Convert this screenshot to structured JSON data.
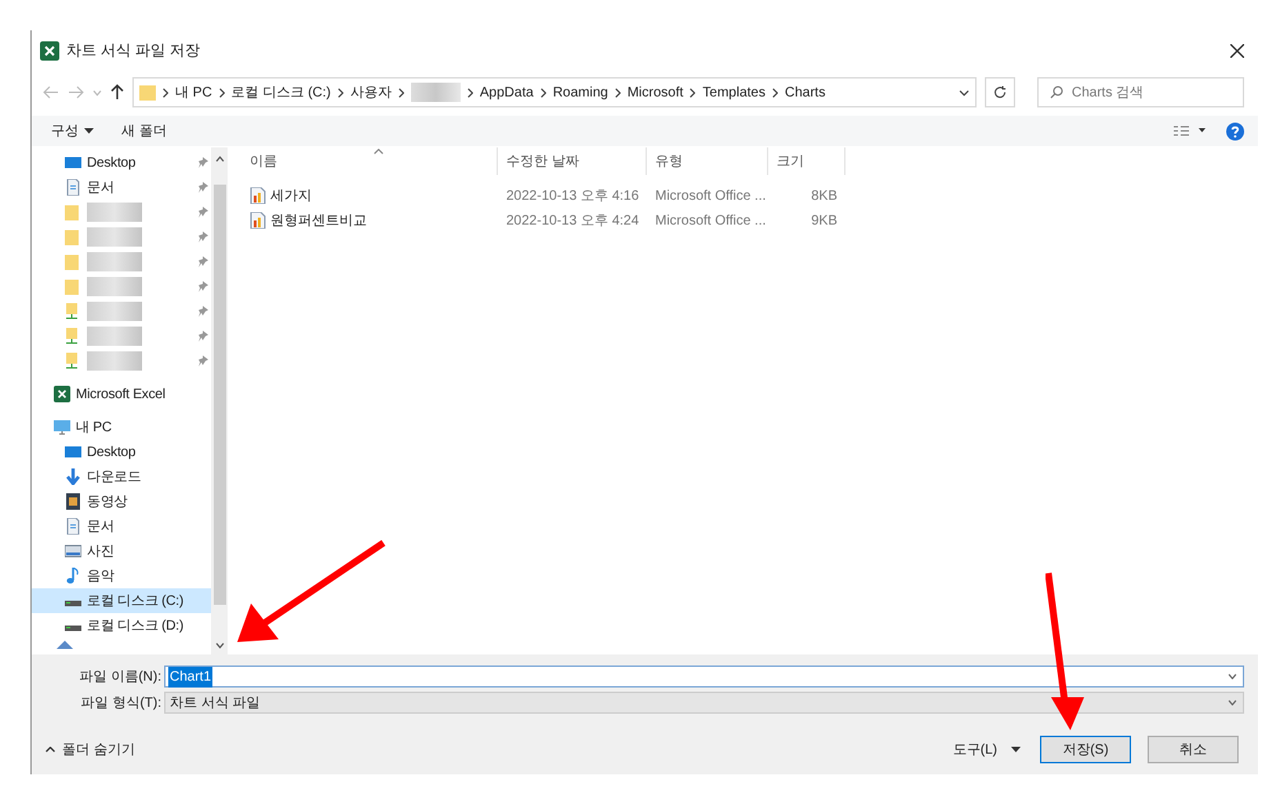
{
  "window": {
    "title": "차트 서식 파일 저장"
  },
  "address": {
    "crumbs": [
      {
        "label": "내 PC",
        "redacted": false
      },
      {
        "label": "로컬 디스크 (C:)",
        "redacted": false
      },
      {
        "label": "사용자",
        "redacted": false
      },
      {
        "redacted": true
      },
      {
        "label": "AppData",
        "redacted": false
      },
      {
        "label": "Roaming",
        "redacted": false
      },
      {
        "label": "Microsoft",
        "redacted": false
      },
      {
        "label": "Templates",
        "redacted": false
      },
      {
        "label": "Charts",
        "redacted": false
      }
    ]
  },
  "search": {
    "placeholder": "Charts 검색"
  },
  "toolbar": {
    "organize": "구성",
    "new_folder": "새 폴더"
  },
  "sidebar": {
    "items": [
      {
        "kind": "desktop",
        "label": "Desktop",
        "pinned": true,
        "selected": false,
        "redacted": false
      },
      {
        "kind": "document",
        "label": "문서",
        "pinned": true,
        "selected": false,
        "redacted": false
      },
      {
        "kind": "folder",
        "pinned": true,
        "selected": false,
        "redacted": true
      },
      {
        "kind": "folder",
        "pinned": true,
        "selected": false,
        "redacted": true
      },
      {
        "kind": "folder",
        "pinned": true,
        "selected": false,
        "redacted": true
      },
      {
        "kind": "folder",
        "pinned": true,
        "selected": false,
        "redacted": true
      },
      {
        "kind": "netfolder",
        "pinned": true,
        "selected": false,
        "redacted": true
      },
      {
        "kind": "netfolder",
        "pinned": true,
        "selected": false,
        "redacted": true
      },
      {
        "kind": "netfolder",
        "pinned": true,
        "selected": false,
        "redacted": true
      },
      {
        "kind": "excel",
        "label": "Microsoft Excel",
        "pinned": false,
        "selected": false,
        "redacted": false,
        "top": true
      },
      {
        "kind": "pc",
        "label": "내 PC",
        "pinned": false,
        "selected": false,
        "redacted": false,
        "top": true,
        "children": [
          {
            "kind": "desktop",
            "label": "Desktop",
            "pinned": false,
            "selected": false,
            "redacted": false
          },
          {
            "kind": "download",
            "label": "다운로드",
            "pinned": false,
            "selected": false,
            "redacted": false
          },
          {
            "kind": "video",
            "label": "동영상",
            "pinned": false,
            "selected": false,
            "redacted": false
          },
          {
            "kind": "document",
            "label": "문서",
            "pinned": false,
            "selected": false,
            "redacted": false
          },
          {
            "kind": "picture",
            "label": "사진",
            "pinned": false,
            "selected": false,
            "redacted": false
          },
          {
            "kind": "music",
            "label": "음악",
            "pinned": false,
            "selected": false,
            "redacted": false
          },
          {
            "kind": "drive",
            "label": "로컬 디스크 (C:)",
            "pinned": false,
            "selected": true,
            "redacted": false
          },
          {
            "kind": "drive",
            "label": "로컬 디스크 (D:)",
            "pinned": false,
            "selected": false,
            "redacted": false
          }
        ]
      }
    ]
  },
  "table": {
    "columns": [
      "이름",
      "수정한 날짜",
      "유형",
      "크기"
    ],
    "rows": [
      {
        "name": "세가지",
        "modified": "2022-10-13 오후 4:16",
        "type": "Microsoft Office ...",
        "size": "8KB"
      },
      {
        "name": "원형퍼센트비교",
        "modified": "2022-10-13 오후 4:24",
        "type": "Microsoft Office ...",
        "size": "9KB"
      }
    ]
  },
  "file_name": {
    "label": "파일 이름(N):",
    "value": "Chart1"
  },
  "file_type": {
    "label": "파일 형식(T):",
    "value": "차트 서식 파일"
  },
  "footer": {
    "hide_folders": "폴더 숨기기",
    "tools": "도구(L)",
    "save": "저장(S)",
    "cancel": "취소"
  }
}
